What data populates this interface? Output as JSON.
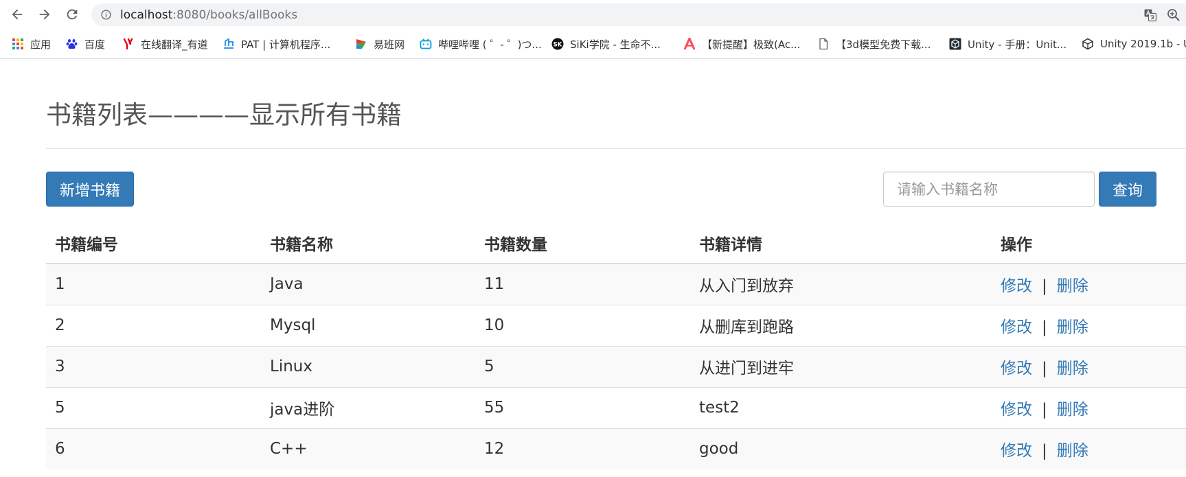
{
  "browser": {
    "url_host": "localhost",
    "url_path": ":8080/books/allBooks",
    "bookmarks": [
      {
        "label": "应用",
        "icon": "apps-grid-icon"
      },
      {
        "label": "百度",
        "icon": "baidu-paw-icon"
      },
      {
        "label": "在线翻译_有道",
        "icon": "youdao-icon"
      },
      {
        "label": "PAT | 计算机程序...",
        "icon": "pat-icon"
      },
      {
        "label": "易班网",
        "icon": "yiban-icon"
      },
      {
        "label": "哔哩哔哩 ( ゜- ゜)つ...",
        "icon": "bilibili-icon"
      },
      {
        "label": "SiKi学院 - 生命不...",
        "icon": "siki-icon"
      },
      {
        "label": "【新提醒】极致(Ac...",
        "icon": "acfun-icon"
      },
      {
        "label": "【3d模型免费下载...",
        "icon": "page-icon"
      },
      {
        "label": "Unity - 手册：Unit...",
        "icon": "unity-icon"
      },
      {
        "label": "Unity 2019.1b - U",
        "icon": "unity-icon"
      }
    ]
  },
  "page": {
    "title": "书籍列表————显示所有书籍",
    "add_button": "新增书籍",
    "search_placeholder": "请输入书籍名称",
    "query_button": "查询"
  },
  "table": {
    "headers": [
      "书籍编号",
      "书籍名称",
      "书籍数量",
      "书籍详情",
      "操作"
    ],
    "rows": [
      {
        "id": "1",
        "name": "Java",
        "count": "11",
        "detail": "从入门到放弃"
      },
      {
        "id": "2",
        "name": "Mysql",
        "count": "10",
        "detail": "从删库到跑路"
      },
      {
        "id": "3",
        "name": "Linux",
        "count": "5",
        "detail": "从进门到进牢"
      },
      {
        "id": "5",
        "name": "java进阶",
        "count": "55",
        "detail": "test2"
      },
      {
        "id": "6",
        "name": "C++",
        "count": "12",
        "detail": "good"
      }
    ],
    "edit_label": "修改",
    "separator": "|",
    "delete_label": "删除"
  },
  "colors": {
    "primary": "#337ab7",
    "link": "#337ab7",
    "stripe": "#f9f9f9"
  }
}
